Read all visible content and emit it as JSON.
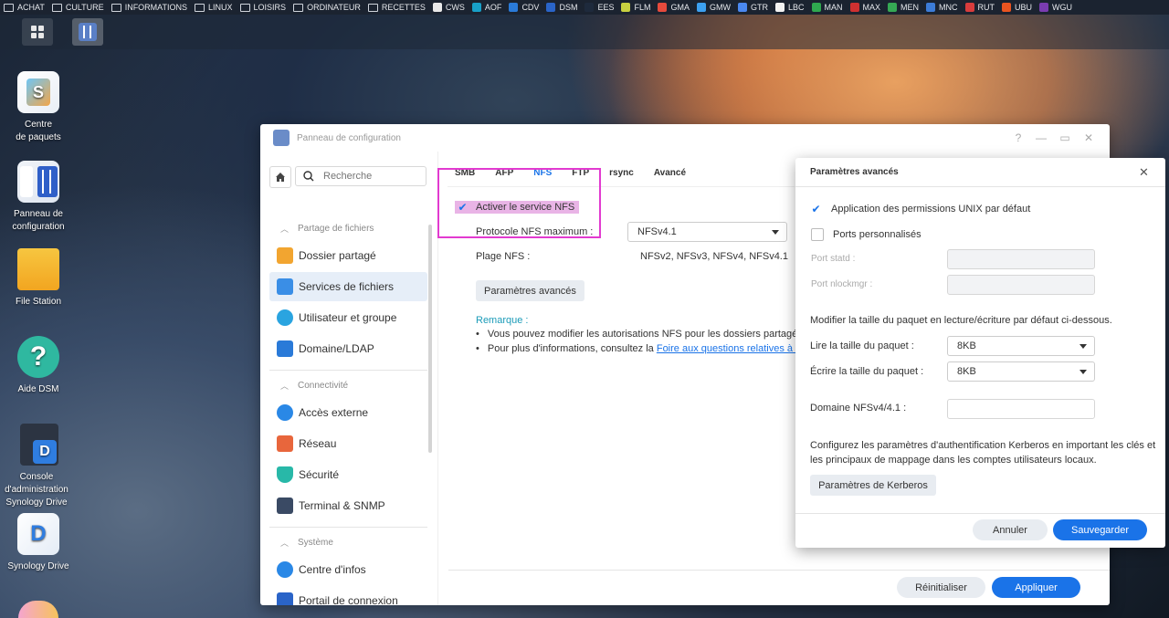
{
  "bookmarks": [
    {
      "label": "ACHAT",
      "icon": "folder-icon",
      "color": "#cfd4dc"
    },
    {
      "label": "CULTURE",
      "icon": "folder-icon",
      "color": "#cfd4dc"
    },
    {
      "label": "INFORMATIONS",
      "icon": "folder-icon",
      "color": "#cfd4dc"
    },
    {
      "label": "LINUX",
      "icon": "folder-icon",
      "color": "#cfd4dc"
    },
    {
      "label": "LOISIRS",
      "icon": "folder-icon",
      "color": "#cfd4dc"
    },
    {
      "label": "ORDINATEUR",
      "icon": "folder-icon",
      "color": "#cfd4dc"
    },
    {
      "label": "RECETTES",
      "icon": "folder-icon",
      "color": "#cfd4dc"
    },
    {
      "label": "CWS",
      "icon": "site-icon",
      "color": "#e9e9e9"
    },
    {
      "label": "AOF",
      "icon": "site-icon",
      "color": "#18a0c8"
    },
    {
      "label": "CDV",
      "icon": "site-icon",
      "color": "#2a7ad8"
    },
    {
      "label": "DSM",
      "icon": "site-icon",
      "color": "#2a64c8"
    },
    {
      "label": "EES",
      "icon": "site-icon",
      "color": "#1e2a3c"
    },
    {
      "label": "FLM",
      "icon": "site-icon",
      "color": "#c8d040"
    },
    {
      "label": "GMA",
      "icon": "site-icon",
      "color": "#e64a3c"
    },
    {
      "label": "GMW",
      "icon": "site-icon",
      "color": "#3ca0f0"
    },
    {
      "label": "GTR",
      "icon": "site-icon",
      "color": "#4a88f0"
    },
    {
      "label": "LBC",
      "icon": "site-icon",
      "color": "#f2f2f2"
    },
    {
      "label": "MAN",
      "icon": "site-icon",
      "color": "#2fa84f"
    },
    {
      "label": "MAX",
      "icon": "site-icon",
      "color": "#cf3030"
    },
    {
      "label": "MEN",
      "icon": "site-icon",
      "color": "#35a854"
    },
    {
      "label": "MNC",
      "icon": "site-icon",
      "color": "#3c7cd8"
    },
    {
      "label": "RUT",
      "icon": "site-icon",
      "color": "#d83c3c"
    },
    {
      "label": "UBU",
      "icon": "site-icon",
      "color": "#e95420"
    },
    {
      "label": "WGU",
      "icon": "site-icon",
      "color": "#7a3cb0"
    }
  ],
  "desktop": [
    {
      "label": "Centre\nde paquets",
      "icon": "package-center-icon"
    },
    {
      "label": "Panneau de\nconfiguration",
      "icon": "control-panel-icon"
    },
    {
      "label": "File Station",
      "icon": "file-station-icon"
    },
    {
      "label": "Aide DSM",
      "icon": "help-icon",
      "glyph": "?"
    },
    {
      "label": "Console d'administration\nSynology Drive",
      "icon": "drive-admin-icon",
      "glyph": "D"
    },
    {
      "label": "Synology Drive",
      "icon": "drive-icon",
      "glyph": "D"
    }
  ],
  "window": {
    "title": "Panneau de configuration",
    "search_placeholder": "Recherche",
    "sections": {
      "file_sharing": "Partage de fichiers",
      "connectivity": "Connectivité",
      "system": "Système"
    },
    "nav": [
      {
        "label": "Dossier partagé",
        "icon": "shared-folder-icon",
        "color": "#f2a530"
      },
      {
        "label": "Services de fichiers",
        "icon": "file-services-icon",
        "color": "#3a8ee6",
        "active": true
      },
      {
        "label": "Utilisateur et groupe",
        "icon": "user-group-icon",
        "color": "#2aa4e0"
      },
      {
        "label": "Domaine/LDAP",
        "icon": "domain-icon",
        "color": "#2a7ad8"
      },
      {
        "label": "Accès externe",
        "icon": "external-access-icon",
        "color": "#2a88e6"
      },
      {
        "label": "Réseau",
        "icon": "network-icon",
        "color": "#e8663c"
      },
      {
        "label": "Sécurité",
        "icon": "security-icon",
        "color": "#28b8a8"
      },
      {
        "label": "Terminal & SNMP",
        "icon": "terminal-icon",
        "color": "#3a4a64"
      },
      {
        "label": "Centre d'infos",
        "icon": "info-center-icon",
        "color": "#2a88e6"
      },
      {
        "label": "Portail de connexion",
        "icon": "login-portal-icon",
        "color": "#2a64c8"
      }
    ],
    "tabs": [
      "SMB",
      "AFP",
      "NFS",
      "FTP",
      "rsync",
      "Avancé"
    ],
    "active_tab": "NFS",
    "enable_nfs": "Activer le service NFS",
    "max_protocol_label": "Protocole NFS maximum :",
    "max_protocol_value": "NFSv4.1",
    "range_label": "Plage NFS :",
    "range_value": "NFSv2, NFSv3, NFSv4, NFSv4.1",
    "advanced_button": "Paramètres avancés",
    "remark_title": "Remarque :",
    "remark_1": "Vous pouvez modifier les autorisations NFS pour les dossiers partagés s",
    "remark_2_prefix": "Pour plus d'informations, consultez la ",
    "remark_2_link": "Foire aux questions relatives à NF",
    "reset_button": "Réinitialiser",
    "apply_button": "Appliquer"
  },
  "dialog": {
    "title": "Paramètres avancés",
    "unix_perm": "Application des permissions UNIX par défaut",
    "custom_ports": "Ports personnalisés",
    "port_statd": "Port statd :",
    "port_nlockmgr": "Port nlockmgr :",
    "packet_note": "Modifier la taille du paquet en lecture/écriture par défaut ci-dessous.",
    "read_label": "Lire la taille du paquet :",
    "read_value": "8KB",
    "write_label": "Écrire la taille du paquet :",
    "write_value": "8KB",
    "domain_label": "Domaine NFSv4/4.1 :",
    "kerberos_note_1": "Configurez les paramètres d'authentification Kerberos en important les clés et",
    "kerberos_note_2": "les principaux de mappage dans les comptes utilisateurs locaux.",
    "kerberos_button": "Paramètres de Kerberos",
    "cancel_button": "Annuler",
    "save_button": "Sauvegarder"
  },
  "colors": {
    "accent": "#1a73e8",
    "highlight": "#e23ad0",
    "primary_button": "#1a73e8"
  }
}
